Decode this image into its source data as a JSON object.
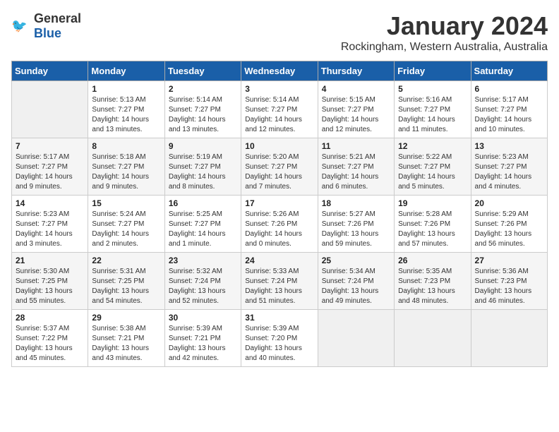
{
  "logo": {
    "general": "General",
    "blue": "Blue"
  },
  "title": "January 2024",
  "subtitle": "Rockingham, Western Australia, Australia",
  "headers": [
    "Sunday",
    "Monday",
    "Tuesday",
    "Wednesday",
    "Thursday",
    "Friday",
    "Saturday"
  ],
  "weeks": [
    [
      {
        "day": "",
        "info": ""
      },
      {
        "day": "1",
        "info": "Sunrise: 5:13 AM\nSunset: 7:27 PM\nDaylight: 14 hours\nand 13 minutes."
      },
      {
        "day": "2",
        "info": "Sunrise: 5:14 AM\nSunset: 7:27 PM\nDaylight: 14 hours\nand 13 minutes."
      },
      {
        "day": "3",
        "info": "Sunrise: 5:14 AM\nSunset: 7:27 PM\nDaylight: 14 hours\nand 12 minutes."
      },
      {
        "day": "4",
        "info": "Sunrise: 5:15 AM\nSunset: 7:27 PM\nDaylight: 14 hours\nand 12 minutes."
      },
      {
        "day": "5",
        "info": "Sunrise: 5:16 AM\nSunset: 7:27 PM\nDaylight: 14 hours\nand 11 minutes."
      },
      {
        "day": "6",
        "info": "Sunrise: 5:17 AM\nSunset: 7:27 PM\nDaylight: 14 hours\nand 10 minutes."
      }
    ],
    [
      {
        "day": "7",
        "info": "Sunrise: 5:17 AM\nSunset: 7:27 PM\nDaylight: 14 hours\nand 9 minutes."
      },
      {
        "day": "8",
        "info": "Sunrise: 5:18 AM\nSunset: 7:27 PM\nDaylight: 14 hours\nand 9 minutes."
      },
      {
        "day": "9",
        "info": "Sunrise: 5:19 AM\nSunset: 7:27 PM\nDaylight: 14 hours\nand 8 minutes."
      },
      {
        "day": "10",
        "info": "Sunrise: 5:20 AM\nSunset: 7:27 PM\nDaylight: 14 hours\nand 7 minutes."
      },
      {
        "day": "11",
        "info": "Sunrise: 5:21 AM\nSunset: 7:27 PM\nDaylight: 14 hours\nand 6 minutes."
      },
      {
        "day": "12",
        "info": "Sunrise: 5:22 AM\nSunset: 7:27 PM\nDaylight: 14 hours\nand 5 minutes."
      },
      {
        "day": "13",
        "info": "Sunrise: 5:23 AM\nSunset: 7:27 PM\nDaylight: 14 hours\nand 4 minutes."
      }
    ],
    [
      {
        "day": "14",
        "info": "Sunrise: 5:23 AM\nSunset: 7:27 PM\nDaylight: 14 hours\nand 3 minutes."
      },
      {
        "day": "15",
        "info": "Sunrise: 5:24 AM\nSunset: 7:27 PM\nDaylight: 14 hours\nand 2 minutes."
      },
      {
        "day": "16",
        "info": "Sunrise: 5:25 AM\nSunset: 7:27 PM\nDaylight: 14 hours\nand 1 minute."
      },
      {
        "day": "17",
        "info": "Sunrise: 5:26 AM\nSunset: 7:26 PM\nDaylight: 14 hours\nand 0 minutes."
      },
      {
        "day": "18",
        "info": "Sunrise: 5:27 AM\nSunset: 7:26 PM\nDaylight: 13 hours\nand 59 minutes."
      },
      {
        "day": "19",
        "info": "Sunrise: 5:28 AM\nSunset: 7:26 PM\nDaylight: 13 hours\nand 57 minutes."
      },
      {
        "day": "20",
        "info": "Sunrise: 5:29 AM\nSunset: 7:26 PM\nDaylight: 13 hours\nand 56 minutes."
      }
    ],
    [
      {
        "day": "21",
        "info": "Sunrise: 5:30 AM\nSunset: 7:25 PM\nDaylight: 13 hours\nand 55 minutes."
      },
      {
        "day": "22",
        "info": "Sunrise: 5:31 AM\nSunset: 7:25 PM\nDaylight: 13 hours\nand 54 minutes."
      },
      {
        "day": "23",
        "info": "Sunrise: 5:32 AM\nSunset: 7:24 PM\nDaylight: 13 hours\nand 52 minutes."
      },
      {
        "day": "24",
        "info": "Sunrise: 5:33 AM\nSunset: 7:24 PM\nDaylight: 13 hours\nand 51 minutes."
      },
      {
        "day": "25",
        "info": "Sunrise: 5:34 AM\nSunset: 7:24 PM\nDaylight: 13 hours\nand 49 minutes."
      },
      {
        "day": "26",
        "info": "Sunrise: 5:35 AM\nSunset: 7:23 PM\nDaylight: 13 hours\nand 48 minutes."
      },
      {
        "day": "27",
        "info": "Sunrise: 5:36 AM\nSunset: 7:23 PM\nDaylight: 13 hours\nand 46 minutes."
      }
    ],
    [
      {
        "day": "28",
        "info": "Sunrise: 5:37 AM\nSunset: 7:22 PM\nDaylight: 13 hours\nand 45 minutes."
      },
      {
        "day": "29",
        "info": "Sunrise: 5:38 AM\nSunset: 7:21 PM\nDaylight: 13 hours\nand 43 minutes."
      },
      {
        "day": "30",
        "info": "Sunrise: 5:39 AM\nSunset: 7:21 PM\nDaylight: 13 hours\nand 42 minutes."
      },
      {
        "day": "31",
        "info": "Sunrise: 5:39 AM\nSunset: 7:20 PM\nDaylight: 13 hours\nand 40 minutes."
      },
      {
        "day": "",
        "info": ""
      },
      {
        "day": "",
        "info": ""
      },
      {
        "day": "",
        "info": ""
      }
    ]
  ]
}
